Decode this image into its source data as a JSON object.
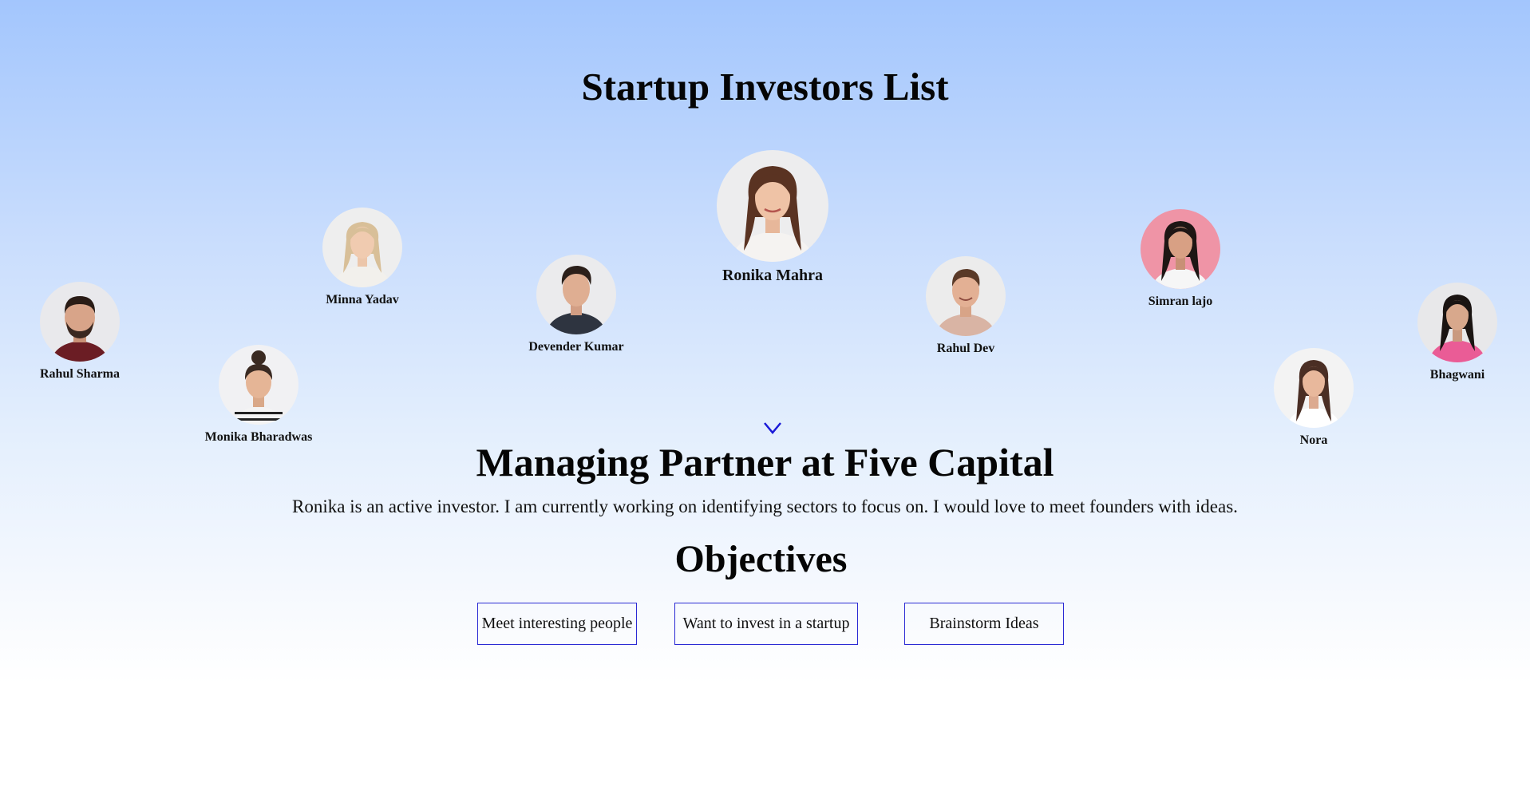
{
  "page": {
    "title": "Startup Investors List"
  },
  "investors": [
    {
      "name": "Rahul Sharma",
      "icon": "male-portrait-beard",
      "featured": false
    },
    {
      "name": "Monika Bharadwas",
      "icon": "female-portrait-bun",
      "featured": false
    },
    {
      "name": "Minna Yadav",
      "icon": "female-portrait-blonde",
      "featured": false
    },
    {
      "name": "Devender Kumar",
      "icon": "male-portrait-dark-shirt",
      "featured": false
    },
    {
      "name": "Ronika Mahra",
      "icon": "female-portrait-long-hair",
      "featured": true
    },
    {
      "name": "Rahul Dev",
      "icon": "male-portrait-smiling",
      "featured": false
    },
    {
      "name": "Simran lajo",
      "icon": "female-portrait-pink-bg",
      "featured": false
    },
    {
      "name": "Nora",
      "icon": "female-portrait-white-top",
      "featured": false
    },
    {
      "name": "Bhagwani",
      "icon": "female-portrait-pink-top",
      "featured": false
    }
  ],
  "selected": {
    "heading": "Managing Partner at Five Capital",
    "description": "Ronika is an active investor. I am currently working on identifying sectors to focus on. I would love to meet founders with ideas."
  },
  "objectives": {
    "title": "Objectives",
    "items": [
      "Meet interesting people",
      "Want to invest in a startup",
      "Brainstorm Ideas"
    ]
  },
  "colors": {
    "accent": "#2a2ad4",
    "arrow": "#1a1ad8",
    "gradient_top": "#a3c6fd",
    "background_bottom": "#ffffff"
  }
}
